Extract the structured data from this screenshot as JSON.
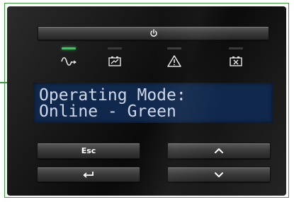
{
  "display": {
    "line1": "Operating Mode:",
    "line2": "Online - Green"
  },
  "buttons": {
    "power_icon": "power-icon",
    "esc_label": "Esc",
    "enter_icon": "enter-arrow-icon",
    "up_icon": "chevron-up-icon",
    "down_icon": "chevron-down-icon"
  },
  "indicators": [
    {
      "icon": "ac-sine-wave-icon",
      "active": true
    },
    {
      "icon": "battery-icon",
      "active": false
    },
    {
      "icon": "warning-triangle-icon",
      "active": false
    },
    {
      "icon": "battery-fault-icon",
      "active": false
    }
  ],
  "colors": {
    "indicator_on": "#3cc65a",
    "lcd_background": "#10284c",
    "lcd_text": "#cfd8e8",
    "callout_border": "#3e9a3e"
  }
}
